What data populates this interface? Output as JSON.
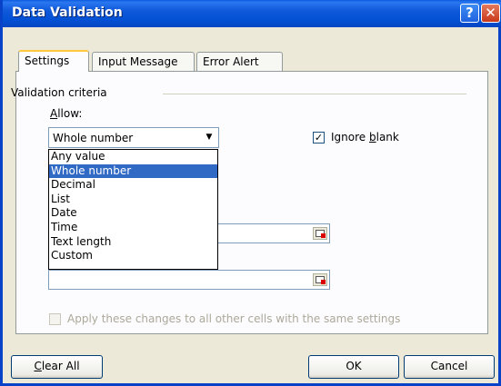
{
  "window": {
    "title": "Data Validation",
    "help_glyph": "?",
    "close_glyph": "✕"
  },
  "tabs": [
    {
      "label": "Settings",
      "active": true
    },
    {
      "label": "Input Message",
      "active": false
    },
    {
      "label": "Error Alert",
      "active": false
    }
  ],
  "settings": {
    "group_title": "Validation criteria",
    "allow": {
      "label_access_key": "A",
      "label_rest": "llow:",
      "selected": "Whole number",
      "options": [
        "Any value",
        "Whole number",
        "Decimal",
        "List",
        "Date",
        "Time",
        "Text length",
        "Custom"
      ],
      "expanded": true
    },
    "ignore_blank": {
      "label_before": "Ignore ",
      "label_access_key": "b",
      "label_after": "lank",
      "checked": true,
      "check_glyph": "✓"
    },
    "apply_all": {
      "label": "Apply these changes to all other cells with the same settings",
      "checked": false,
      "enabled": false
    }
  },
  "buttons": {
    "clear_all_access_key": "C",
    "clear_all_rest": "lear All",
    "ok": "OK",
    "cancel": "Cancel"
  },
  "colors": {
    "titlebar": "#0A5BDE",
    "selection": "#316AC5",
    "dialog_bg": "#ECE9D8",
    "active_tab_accent": "#FFC83C"
  }
}
